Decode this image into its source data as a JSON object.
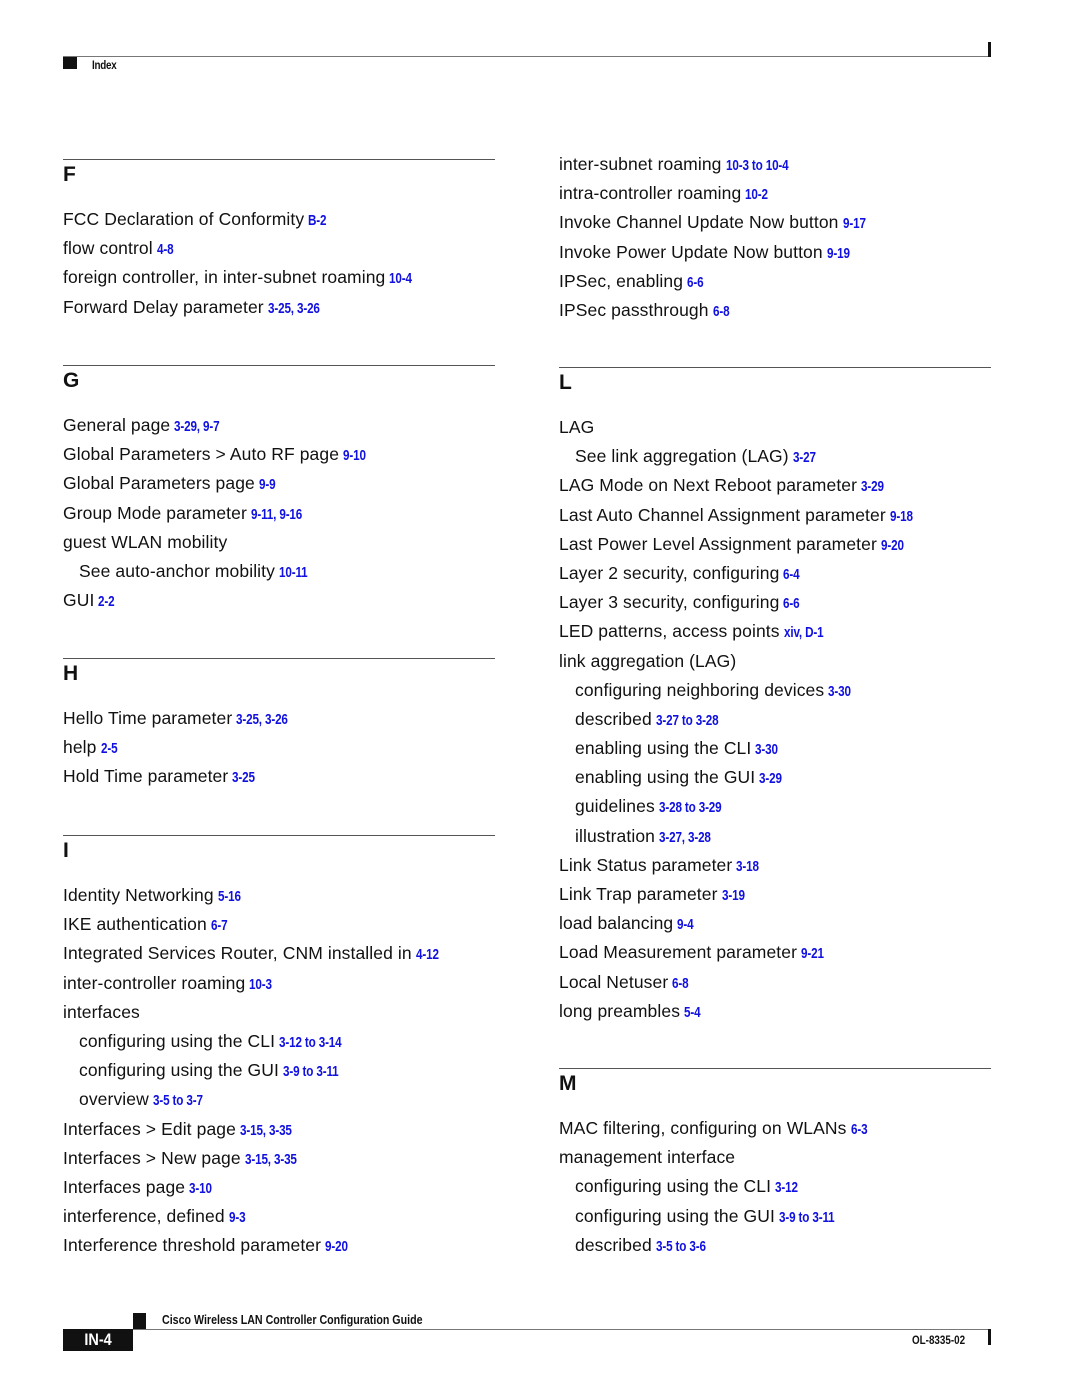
{
  "header": {
    "label": "Index"
  },
  "colors": {
    "page_ref": "#1010e0",
    "text": "#111111"
  },
  "left_column": {
    "sections": [
      {
        "letter": "F",
        "entries": [
          {
            "text": "FCC Declaration of Conformity",
            "pages": "B-2",
            "level": 0
          },
          {
            "text": "flow control",
            "pages": "4-8",
            "level": 0
          },
          {
            "text": "foreign controller, in inter-subnet roaming",
            "pages": "10-4",
            "level": 0
          },
          {
            "text": "Forward Delay parameter",
            "pages": "3-25, 3-26",
            "level": 0
          }
        ]
      },
      {
        "letter": "G",
        "entries": [
          {
            "text": "General page",
            "pages": "3-29, 9-7",
            "level": 0
          },
          {
            "text": "Global Parameters > Auto RF page",
            "pages": "9-10",
            "level": 0
          },
          {
            "text": "Global Parameters page",
            "pages": "9-9",
            "level": 0
          },
          {
            "text": "Group Mode parameter",
            "pages": "9-11, 9-16",
            "level": 0
          },
          {
            "text": "guest WLAN mobility",
            "pages": "",
            "level": 0
          },
          {
            "text": "See auto-anchor mobility",
            "pages": "10-11",
            "level": 1
          },
          {
            "text": "GUI",
            "pages": "2-2",
            "level": 0
          }
        ]
      },
      {
        "letter": "H",
        "entries": [
          {
            "text": "Hello Time parameter",
            "pages": "3-25, 3-26",
            "level": 0
          },
          {
            "text": "help",
            "pages": "2-5",
            "level": 0
          },
          {
            "text": "Hold Time parameter",
            "pages": "3-25",
            "level": 0
          }
        ]
      },
      {
        "letter": "I",
        "entries": [
          {
            "text": "Identity Networking",
            "pages": "5-16",
            "level": 0
          },
          {
            "text": "IKE authentication",
            "pages": "6-7",
            "level": 0
          },
          {
            "text": "Integrated Services Router, CNM installed in",
            "pages": "4-12",
            "level": 0
          },
          {
            "text": "inter-controller roaming",
            "pages": "10-3",
            "level": 0
          },
          {
            "text": "interfaces",
            "pages": "",
            "level": 0
          },
          {
            "text": "configuring using the CLI",
            "pages": "3-12 to 3-14",
            "level": 1
          },
          {
            "text": "configuring using the GUI",
            "pages": "3-9 to 3-11",
            "level": 1
          },
          {
            "text": "overview",
            "pages": "3-5 to 3-7",
            "level": 1
          },
          {
            "text": "Interfaces > Edit page",
            "pages": "3-15, 3-35",
            "level": 0
          },
          {
            "text": "Interfaces > New page",
            "pages": "3-15, 3-35",
            "level": 0
          },
          {
            "text": "Interfaces page",
            "pages": "3-10",
            "level": 0
          },
          {
            "text": "interference, defined",
            "pages": "9-3",
            "level": 0
          },
          {
            "text": "Interference threshold parameter",
            "pages": "9-20",
            "level": 0
          }
        ]
      }
    ]
  },
  "right_column": {
    "continued_entries": [
      {
        "text": "inter-subnet roaming",
        "pages": "10-3 to 10-4",
        "level": 0
      },
      {
        "text": "intra-controller roaming",
        "pages": "10-2",
        "level": 0
      },
      {
        "text": "Invoke Channel Update Now button",
        "pages": "9-17",
        "level": 0
      },
      {
        "text": "Invoke Power Update Now button",
        "pages": "9-19",
        "level": 0
      },
      {
        "text": "IPSec, enabling",
        "pages": "6-6",
        "level": 0
      },
      {
        "text": "IPSec passthrough",
        "pages": "6-8",
        "level": 0
      }
    ],
    "sections": [
      {
        "letter": "L",
        "entries": [
          {
            "text": "LAG",
            "pages": "",
            "level": 0
          },
          {
            "text": "See link aggregation (LAG)",
            "pages": "3-27",
            "level": 1
          },
          {
            "text": "LAG Mode on Next Reboot parameter",
            "pages": "3-29",
            "level": 0
          },
          {
            "text": "Last Auto Channel Assignment parameter",
            "pages": "9-18",
            "level": 0
          },
          {
            "text": "Last Power Level Assignment parameter",
            "pages": "9-20",
            "level": 0
          },
          {
            "text": "Layer 2 security, configuring",
            "pages": "6-4",
            "level": 0
          },
          {
            "text": "Layer 3 security, configuring",
            "pages": "6-6",
            "level": 0
          },
          {
            "text": "LED patterns, access points",
            "pages": "xiv, D-1",
            "level": 0
          },
          {
            "text": "link aggregation (LAG)",
            "pages": "",
            "level": 0
          },
          {
            "text": "configuring neighboring devices",
            "pages": "3-30",
            "level": 1
          },
          {
            "text": "described",
            "pages": "3-27 to 3-28",
            "level": 1
          },
          {
            "text": "enabling using the CLI",
            "pages": "3-30",
            "level": 1
          },
          {
            "text": "enabling using the GUI",
            "pages": "3-29",
            "level": 1
          },
          {
            "text": "guidelines",
            "pages": "3-28 to 3-29",
            "level": 1
          },
          {
            "text": "illustration",
            "pages": "3-27, 3-28",
            "level": 1
          },
          {
            "text": "Link Status parameter",
            "pages": "3-18",
            "level": 0
          },
          {
            "text": "Link Trap parameter",
            "pages": "3-19",
            "level": 0
          },
          {
            "text": "load balancing",
            "pages": "9-4",
            "level": 0
          },
          {
            "text": "Load Measurement parameter",
            "pages": "9-21",
            "level": 0
          },
          {
            "text": "Local Netuser",
            "pages": "6-8",
            "level": 0
          },
          {
            "text": "long preambles",
            "pages": "5-4",
            "level": 0
          }
        ]
      },
      {
        "letter": "M",
        "entries": [
          {
            "text": "MAC filtering, configuring on WLANs",
            "pages": "6-3",
            "level": 0
          },
          {
            "text": "management interface",
            "pages": "",
            "level": 0
          },
          {
            "text": "configuring using the CLI",
            "pages": "3-12",
            "level": 1
          },
          {
            "text": "configuring using the GUI",
            "pages": "3-9 to 3-11",
            "level": 1
          },
          {
            "text": "described",
            "pages": "3-5 to 3-6",
            "level": 1
          }
        ]
      }
    ]
  },
  "footer": {
    "book_title": "Cisco Wireless LAN Controller Configuration Guide",
    "page_number": "IN-4",
    "doc_number": "OL-8335-02"
  }
}
